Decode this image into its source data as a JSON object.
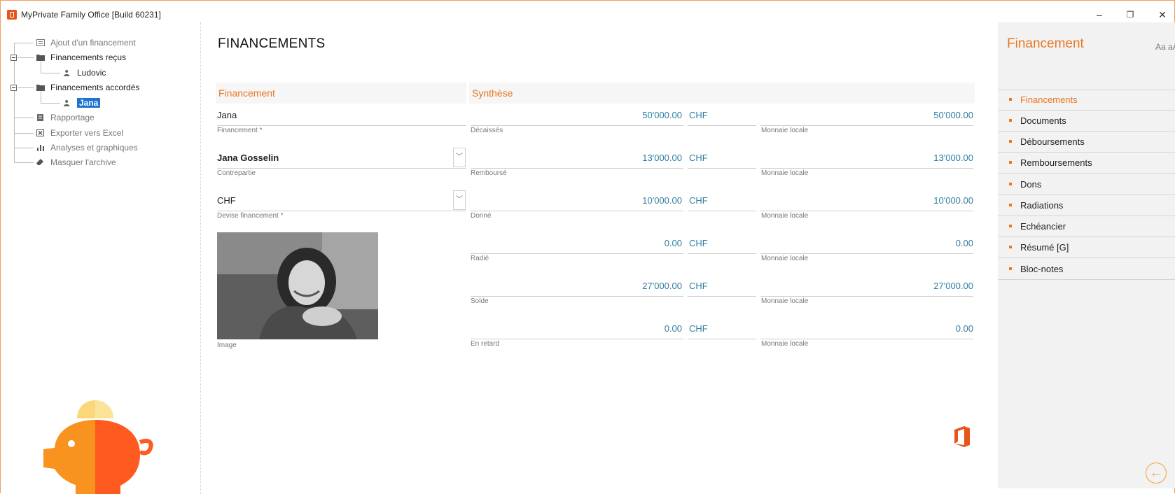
{
  "window": {
    "title": "MyPrivate Family Office [Build 60231]",
    "minimize": "–",
    "restore": "❐",
    "close": "✕"
  },
  "tree": {
    "add_financing": "Ajout d'un financement",
    "received": "Financements reçus",
    "received_child": "Ludovic",
    "granted": "Financements accordés",
    "granted_child": "Jana",
    "reporting": "Rapportage",
    "export_excel": "Exporter vers Excel",
    "analyses": "Analyses et graphiques",
    "hide_archive": "Masquer l'archive"
  },
  "main": {
    "title": "FINANCEMENTS",
    "section_financing": "Financement",
    "section_summary": "Synthèse",
    "financing_value": "Jana",
    "financing_label": "Financement *",
    "counterparty_value": "Jana Gosselin",
    "counterparty_label": "Contrepartie",
    "currency_value": "CHF",
    "currency_label": "Devise financement *",
    "image_label": "Image"
  },
  "summary_rows": [
    {
      "label": "Décaissés",
      "amount": "50'000.00",
      "currency": "CHF",
      "local": "50'000.00",
      "local_label": "Monnaie locale"
    },
    {
      "label": "Remboursé",
      "amount": "13'000.00",
      "currency": "CHF",
      "local": "13'000.00",
      "local_label": "Monnaie locale"
    },
    {
      "label": "Donné",
      "amount": "10'000.00",
      "currency": "CHF",
      "local": "10'000.00",
      "local_label": "Monnaie locale"
    },
    {
      "label": "Radié",
      "amount": "0.00",
      "currency": "CHF",
      "local": "0.00",
      "local_label": "Monnaie locale"
    },
    {
      "label": "Solde",
      "amount": "27'000.00",
      "currency": "CHF",
      "local": "27'000.00",
      "local_label": "Monnaie locale"
    },
    {
      "label": "En retard",
      "amount": "0.00",
      "currency": "CHF",
      "local": "0.00",
      "local_label": "Monnaie locale"
    }
  ],
  "right_panel": {
    "title": "Financement",
    "font_size_label": "Aa aA",
    "items": [
      "Financements",
      "Documents",
      "Déboursements",
      "Remboursements",
      "Dons",
      "Radiations",
      "Echéancier",
      "Résumé [G]",
      "Bloc-notes"
    ]
  },
  "colors": {
    "accent": "#e87722",
    "value_blue": "#2f7ea0",
    "selection": "#1e74d0"
  }
}
